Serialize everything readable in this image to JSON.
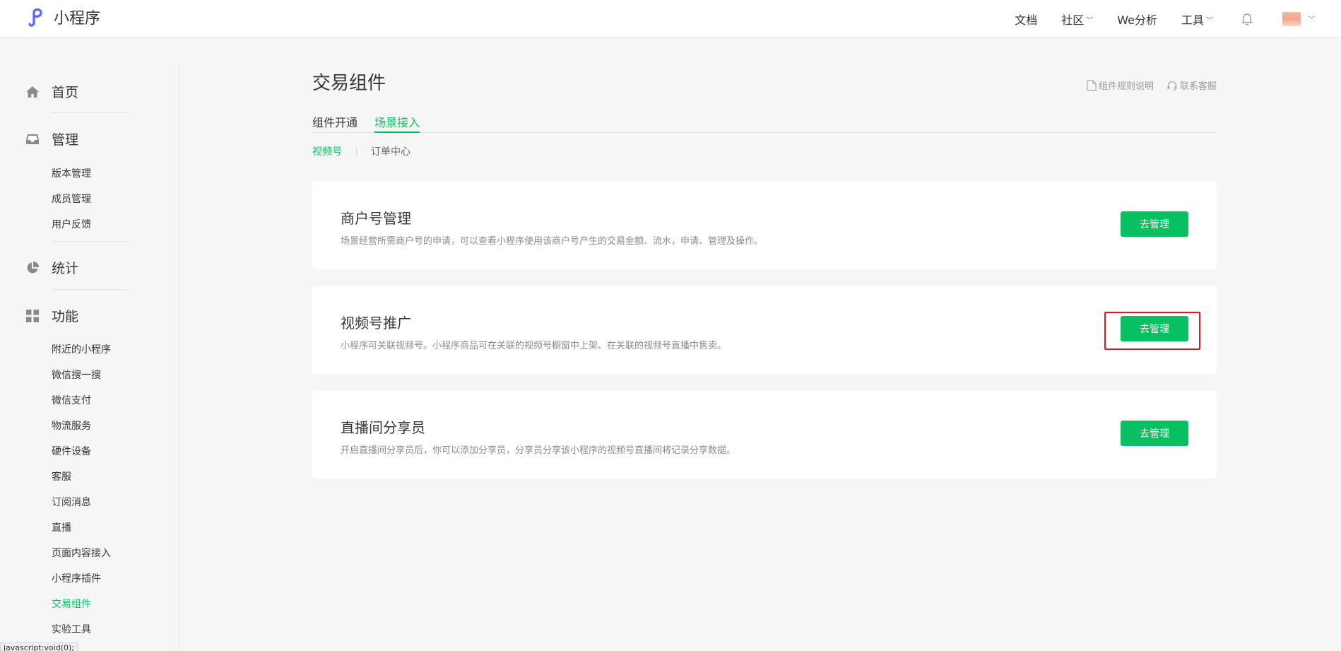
{
  "header": {
    "logo_text": "小程序",
    "nav": [
      {
        "label": "文档",
        "has_dropdown": false
      },
      {
        "label": "社区",
        "has_dropdown": true
      },
      {
        "label": "We分析",
        "has_dropdown": false
      },
      {
        "label": "工具",
        "has_dropdown": true
      }
    ],
    "brand_color": "#6467f0"
  },
  "sidebar": {
    "groups": [
      {
        "label": "首页",
        "icon": "home-icon"
      },
      {
        "label": "管理",
        "icon": "inbox-icon",
        "items": [
          "版本管理",
          "成员管理",
          "用户反馈"
        ]
      },
      {
        "label": "统计",
        "icon": "pie-chart-icon"
      },
      {
        "label": "功能",
        "icon": "grid-icon",
        "items": [
          "附近的小程序",
          "微信搜一搜",
          "微信支付",
          "物流服务",
          "硬件设备",
          "客服",
          "订阅消息",
          "直播",
          "页面内容接入",
          "小程序插件",
          "交易组件",
          "实验工具"
        ]
      }
    ],
    "active_item": "交易组件",
    "accent_color": "#07c160"
  },
  "status_bar": {
    "text": "javascript:void(0);"
  },
  "main": {
    "title": "交易组件",
    "help_links": [
      {
        "label": "组件规则说明",
        "icon": "document-icon"
      },
      {
        "label": "联系客服",
        "icon": "headset-icon"
      }
    ],
    "tabs": [
      {
        "label": "组件开通",
        "active": false
      },
      {
        "label": "场景接入",
        "active": true
      }
    ],
    "subtabs": [
      {
        "label": "视频号",
        "active": true
      },
      {
        "label": "订单中心",
        "active": false
      }
    ],
    "cards": [
      {
        "title": "商户号管理",
        "desc": "场景经营所需商户号的申请，可以查看小程序使用该商户号产生的交易金额、流水，申请、管理及操作。",
        "button": "去管理",
        "highlighted": false
      },
      {
        "title": "视频号推广",
        "desc": "小程序可关联视频号。小程序商品可在关联的视频号橱窗中上架、在关联的视频号直播中售卖。",
        "button": "去管理",
        "highlighted": true
      },
      {
        "title": "直播间分享员",
        "desc": "开启直播间分享员后，你可以添加分享员，分享员分享该小程序的视频号直播间将记录分享数据。",
        "button": "去管理",
        "highlighted": false
      }
    ],
    "button_color": "#07c160",
    "highlight_color": "#e6141e"
  }
}
